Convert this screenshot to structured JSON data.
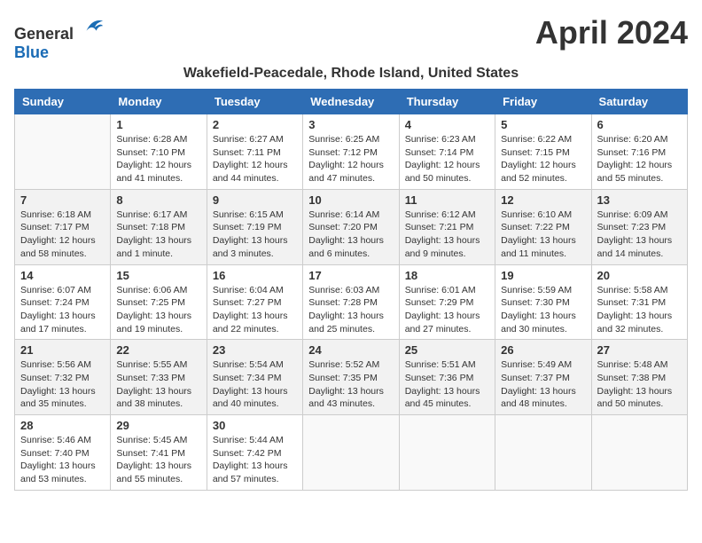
{
  "header": {
    "logo_general": "General",
    "logo_blue": "Blue",
    "month_title": "April 2024",
    "location": "Wakefield-Peacedale, Rhode Island, United States"
  },
  "weekdays": [
    "Sunday",
    "Monday",
    "Tuesday",
    "Wednesday",
    "Thursday",
    "Friday",
    "Saturday"
  ],
  "weeks": [
    [
      {
        "day": "",
        "info": ""
      },
      {
        "day": "1",
        "info": "Sunrise: 6:28 AM\nSunset: 7:10 PM\nDaylight: 12 hours\nand 41 minutes."
      },
      {
        "day": "2",
        "info": "Sunrise: 6:27 AM\nSunset: 7:11 PM\nDaylight: 12 hours\nand 44 minutes."
      },
      {
        "day": "3",
        "info": "Sunrise: 6:25 AM\nSunset: 7:12 PM\nDaylight: 12 hours\nand 47 minutes."
      },
      {
        "day": "4",
        "info": "Sunrise: 6:23 AM\nSunset: 7:14 PM\nDaylight: 12 hours\nand 50 minutes."
      },
      {
        "day": "5",
        "info": "Sunrise: 6:22 AM\nSunset: 7:15 PM\nDaylight: 12 hours\nand 52 minutes."
      },
      {
        "day": "6",
        "info": "Sunrise: 6:20 AM\nSunset: 7:16 PM\nDaylight: 12 hours\nand 55 minutes."
      }
    ],
    [
      {
        "day": "7",
        "info": "Sunrise: 6:18 AM\nSunset: 7:17 PM\nDaylight: 12 hours\nand 58 minutes."
      },
      {
        "day": "8",
        "info": "Sunrise: 6:17 AM\nSunset: 7:18 PM\nDaylight: 13 hours\nand 1 minute."
      },
      {
        "day": "9",
        "info": "Sunrise: 6:15 AM\nSunset: 7:19 PM\nDaylight: 13 hours\nand 3 minutes."
      },
      {
        "day": "10",
        "info": "Sunrise: 6:14 AM\nSunset: 7:20 PM\nDaylight: 13 hours\nand 6 minutes."
      },
      {
        "day": "11",
        "info": "Sunrise: 6:12 AM\nSunset: 7:21 PM\nDaylight: 13 hours\nand 9 minutes."
      },
      {
        "day": "12",
        "info": "Sunrise: 6:10 AM\nSunset: 7:22 PM\nDaylight: 13 hours\nand 11 minutes."
      },
      {
        "day": "13",
        "info": "Sunrise: 6:09 AM\nSunset: 7:23 PM\nDaylight: 13 hours\nand 14 minutes."
      }
    ],
    [
      {
        "day": "14",
        "info": "Sunrise: 6:07 AM\nSunset: 7:24 PM\nDaylight: 13 hours\nand 17 minutes."
      },
      {
        "day": "15",
        "info": "Sunrise: 6:06 AM\nSunset: 7:25 PM\nDaylight: 13 hours\nand 19 minutes."
      },
      {
        "day": "16",
        "info": "Sunrise: 6:04 AM\nSunset: 7:27 PM\nDaylight: 13 hours\nand 22 minutes."
      },
      {
        "day": "17",
        "info": "Sunrise: 6:03 AM\nSunset: 7:28 PM\nDaylight: 13 hours\nand 25 minutes."
      },
      {
        "day": "18",
        "info": "Sunrise: 6:01 AM\nSunset: 7:29 PM\nDaylight: 13 hours\nand 27 minutes."
      },
      {
        "day": "19",
        "info": "Sunrise: 5:59 AM\nSunset: 7:30 PM\nDaylight: 13 hours\nand 30 minutes."
      },
      {
        "day": "20",
        "info": "Sunrise: 5:58 AM\nSunset: 7:31 PM\nDaylight: 13 hours\nand 32 minutes."
      }
    ],
    [
      {
        "day": "21",
        "info": "Sunrise: 5:56 AM\nSunset: 7:32 PM\nDaylight: 13 hours\nand 35 minutes."
      },
      {
        "day": "22",
        "info": "Sunrise: 5:55 AM\nSunset: 7:33 PM\nDaylight: 13 hours\nand 38 minutes."
      },
      {
        "day": "23",
        "info": "Sunrise: 5:54 AM\nSunset: 7:34 PM\nDaylight: 13 hours\nand 40 minutes."
      },
      {
        "day": "24",
        "info": "Sunrise: 5:52 AM\nSunset: 7:35 PM\nDaylight: 13 hours\nand 43 minutes."
      },
      {
        "day": "25",
        "info": "Sunrise: 5:51 AM\nSunset: 7:36 PM\nDaylight: 13 hours\nand 45 minutes."
      },
      {
        "day": "26",
        "info": "Sunrise: 5:49 AM\nSunset: 7:37 PM\nDaylight: 13 hours\nand 48 minutes."
      },
      {
        "day": "27",
        "info": "Sunrise: 5:48 AM\nSunset: 7:38 PM\nDaylight: 13 hours\nand 50 minutes."
      }
    ],
    [
      {
        "day": "28",
        "info": "Sunrise: 5:46 AM\nSunset: 7:40 PM\nDaylight: 13 hours\nand 53 minutes."
      },
      {
        "day": "29",
        "info": "Sunrise: 5:45 AM\nSunset: 7:41 PM\nDaylight: 13 hours\nand 55 minutes."
      },
      {
        "day": "30",
        "info": "Sunrise: 5:44 AM\nSunset: 7:42 PM\nDaylight: 13 hours\nand 57 minutes."
      },
      {
        "day": "",
        "info": ""
      },
      {
        "day": "",
        "info": ""
      },
      {
        "day": "",
        "info": ""
      },
      {
        "day": "",
        "info": ""
      }
    ]
  ]
}
